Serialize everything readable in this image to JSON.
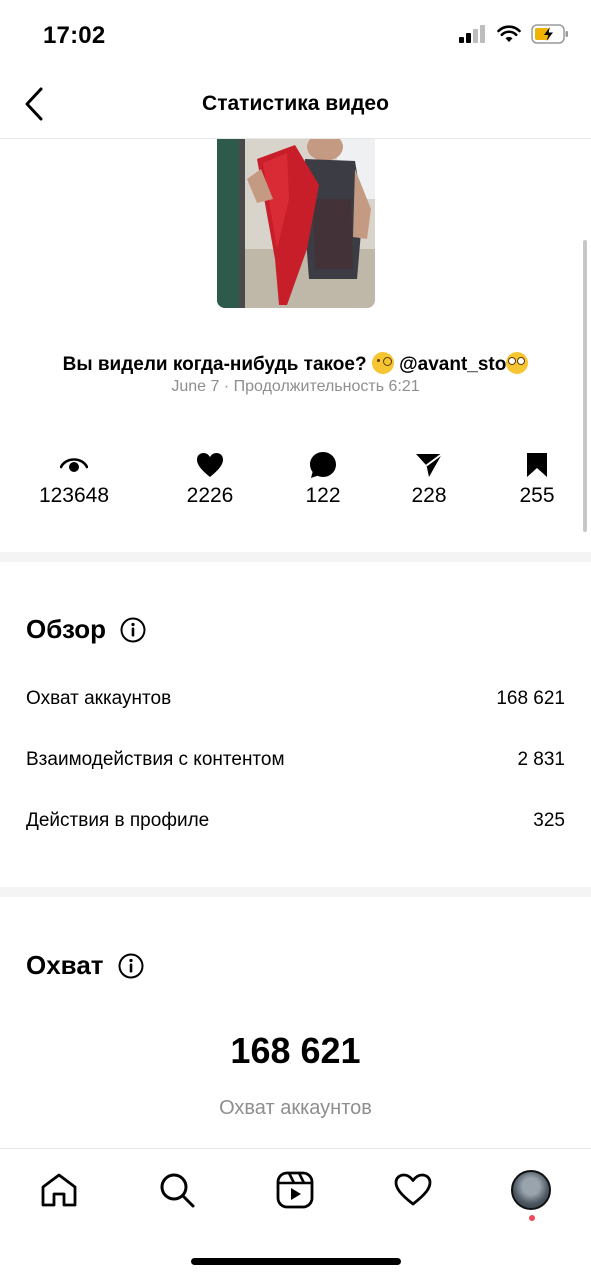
{
  "status_bar": {
    "time": "17:02"
  },
  "header": {
    "title": "Статистика видео"
  },
  "video": {
    "caption": "Вы видели когда-нибудь такое?",
    "mention": "@avant_sto",
    "meta": "June 7 · Продолжительность 6:21"
  },
  "metrics": {
    "views": "123648",
    "likes": "2226",
    "comments": "122",
    "shares": "228",
    "saves": "255"
  },
  "overview": {
    "title": "Обзор",
    "rows": [
      {
        "label": "Охват аккаунтов",
        "value": "168 621"
      },
      {
        "label": "Взаимодействия с контентом",
        "value": "2 831"
      },
      {
        "label": "Действия в профиле",
        "value": "325"
      }
    ]
  },
  "reach": {
    "title": "Охват",
    "value": "168 621",
    "label": "Охват аккаунтов"
  },
  "icons": {
    "views": "eye-icon",
    "likes": "heart-icon",
    "comments": "comment-icon",
    "shares": "share-icon",
    "saves": "bookmark-icon"
  },
  "colors": {
    "notification_dot": "#ed4956",
    "secondary_text": "#8e8e8e"
  }
}
